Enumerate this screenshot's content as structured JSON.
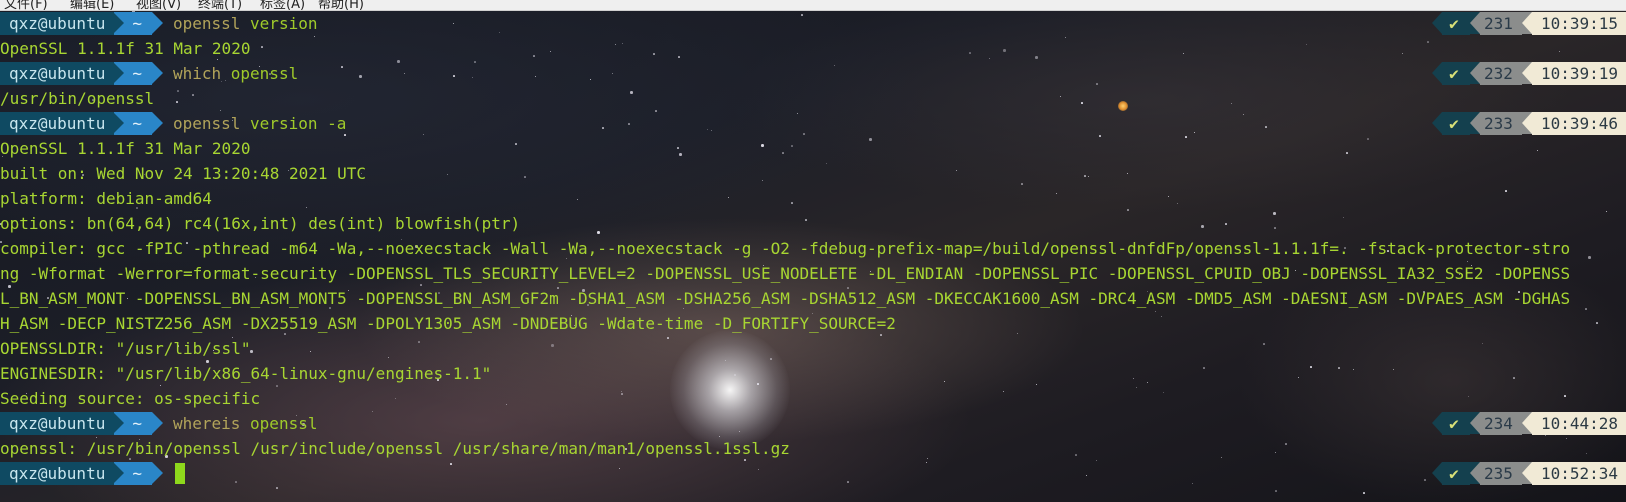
{
  "menubar": {
    "items": [
      "文件(F)",
      "编辑(E)",
      "视图(V)",
      "终端(T)",
      "标签(A)",
      "帮助(H)"
    ]
  },
  "prompt": {
    "user": "qxz@ubuntu",
    "dir": "~",
    "check": "✔"
  },
  "lines": [
    {
      "type": "prompt",
      "cmd": "openssl",
      "args": " version",
      "history": "231",
      "time": "10:39:15"
    },
    {
      "type": "output",
      "text": "OpenSSL 1.1.1f  31 Mar 2020"
    },
    {
      "type": "prompt",
      "cmd": "which",
      "args": " openssl",
      "history": "232",
      "time": "10:39:19"
    },
    {
      "type": "output",
      "text": "/usr/bin/openssl"
    },
    {
      "type": "prompt",
      "cmd": "openssl",
      "args": " version -a",
      "history": "233",
      "time": "10:39:46"
    },
    {
      "type": "output",
      "text": "OpenSSL 1.1.1f  31 Mar 2020"
    },
    {
      "type": "output",
      "text": "built on: Wed Nov 24 13:20:48 2021 UTC"
    },
    {
      "type": "output",
      "text": "platform: debian-amd64"
    },
    {
      "type": "output",
      "text": "options:  bn(64,64) rc4(16x,int) des(int) blowfish(ptr)"
    },
    {
      "type": "output",
      "text": "compiler: gcc -fPIC -pthread -m64 -Wa,--noexecstack -Wall -Wa,--noexecstack -g -O2 -fdebug-prefix-map=/build/openssl-dnfdFp/openssl-1.1.1f=. -fstack-protector-stro"
    },
    {
      "type": "output",
      "text": "ng -Wformat -Werror=format-security -DOPENSSL_TLS_SECURITY_LEVEL=2 -DOPENSSL_USE_NODELETE -DL_ENDIAN -DOPENSSL_PIC -DOPENSSL_CPUID_OBJ -DOPENSSL_IA32_SSE2 -DOPENSS"
    },
    {
      "type": "output",
      "text": "L_BN_ASM_MONT -DOPENSSL_BN_ASM_MONT5 -DOPENSSL_BN_ASM_GF2m -DSHA1_ASM -DSHA256_ASM -DSHA512_ASM -DKECCAK1600_ASM -DRC4_ASM -DMD5_ASM -DAESNI_ASM -DVPAES_ASM -DGHAS"
    },
    {
      "type": "output",
      "text": "H_ASM -DECP_NISTZ256_ASM -DX25519_ASM -DPOLY1305_ASM -DNDEBUG -Wdate-time -D_FORTIFY_SOURCE=2"
    },
    {
      "type": "output",
      "text": "OPENSSLDIR: \"/usr/lib/ssl\""
    },
    {
      "type": "output",
      "text": "ENGINESDIR: \"/usr/lib/x86_64-linux-gnu/engines-1.1\""
    },
    {
      "type": "output",
      "text": "Seeding source: os-specific"
    },
    {
      "type": "prompt",
      "cmd": "whereis",
      "args": " openssl",
      "history": "234",
      "time": "10:44:28"
    },
    {
      "type": "output",
      "text": "openssl: /usr/bin/openssl /usr/include/openssl /usr/share/man/man1/openssl.1ssl.gz"
    },
    {
      "type": "prompt",
      "cmd": "",
      "args": "",
      "history": "235",
      "time": "10:52:34",
      "cursor": true
    }
  ],
  "colors": {
    "user_bg": "#0f4a62",
    "dir_bg": "#2a86c8",
    "text_green": "#a8d632",
    "cursor": "#8ed81c",
    "time_bg": "#f1ead6",
    "history_bg": "#8b8d8c"
  }
}
